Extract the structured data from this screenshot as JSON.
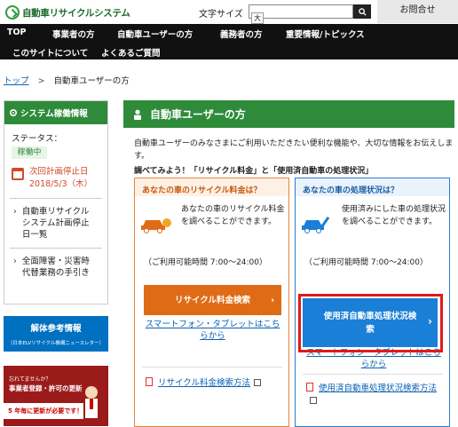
{
  "header": {
    "logo_text": "自動車リサイクルシステム",
    "fontsize_label": "文字サイズ",
    "fontsize_button": "大",
    "search_placeholder": "",
    "contact_label": "お問合せ"
  },
  "nav": {
    "items": [
      "TOP",
      "事業者の方",
      "自動車ユーザーの方",
      "義務者の方",
      "重要情報/トピックス",
      "このサイトについて",
      "よくあるご質問"
    ]
  },
  "breadcrumb": {
    "home": "トップ",
    "sep": ">",
    "current": "自動車ユーザーの方"
  },
  "sidebar": {
    "title": "システム稼働情報",
    "status_label": "ステータス：",
    "status_value": "稼働中",
    "stop_label": "次回計画停止日",
    "stop_date": "2018/5/3（木）",
    "links": [
      {
        "line1": "自動車リサイクル",
        "line2": "システム計画停止",
        "line3": "日一覧"
      },
      {
        "line1": "全面障害・災害時",
        "line2": "代替業務の手引き",
        "line3": ""
      }
    ],
    "ref_title": "解体参考情報",
    "ref_sub": "（日本ELVリサイクル機構ニュースレター）",
    "ad_line1": "忘れてませんか？",
    "ad_line2": "事業者登録・許可の更新",
    "ad_line3": "5 年毎に更新が必要です！"
  },
  "main": {
    "title": "自動車ユーザーの方",
    "intro": "自動車ユーザーのみなさまにご利用いただきたい便利な機能や、大切な情報をお伝えします。",
    "subhead": "調べてみよう！「リサイクル料金」と「使用済自動車の処理状況」",
    "left_card": {
      "head": "あなたの車のリサイクル料金は？",
      "desc": "あなたの車のリサイクル料金を調べることができます。",
      "avail": "（ご利用可能時間 7:00～24:00）",
      "button": "リサイクル料金検索",
      "sp_link": "スマートフォン・タブレットはこちらから",
      "manual": "リサイクル料金検索方法"
    },
    "right_card": {
      "head": "あなたの車の処理状況は？",
      "desc": "使用済みにした車の処理状況を調べることができます。",
      "avail": "（ご利用可能時間 7:00～24:00）",
      "button": "使用済自動車処理状況検索",
      "sp_link": "スマートフォン・タブレットはこちらから",
      "manual": "使用済自動車処理状況検索方法"
    }
  },
  "colors": {
    "green": "#2e8b3a",
    "orange": "#e06b16",
    "blue": "#1a7fd6",
    "highlight": "#e01a1a"
  }
}
